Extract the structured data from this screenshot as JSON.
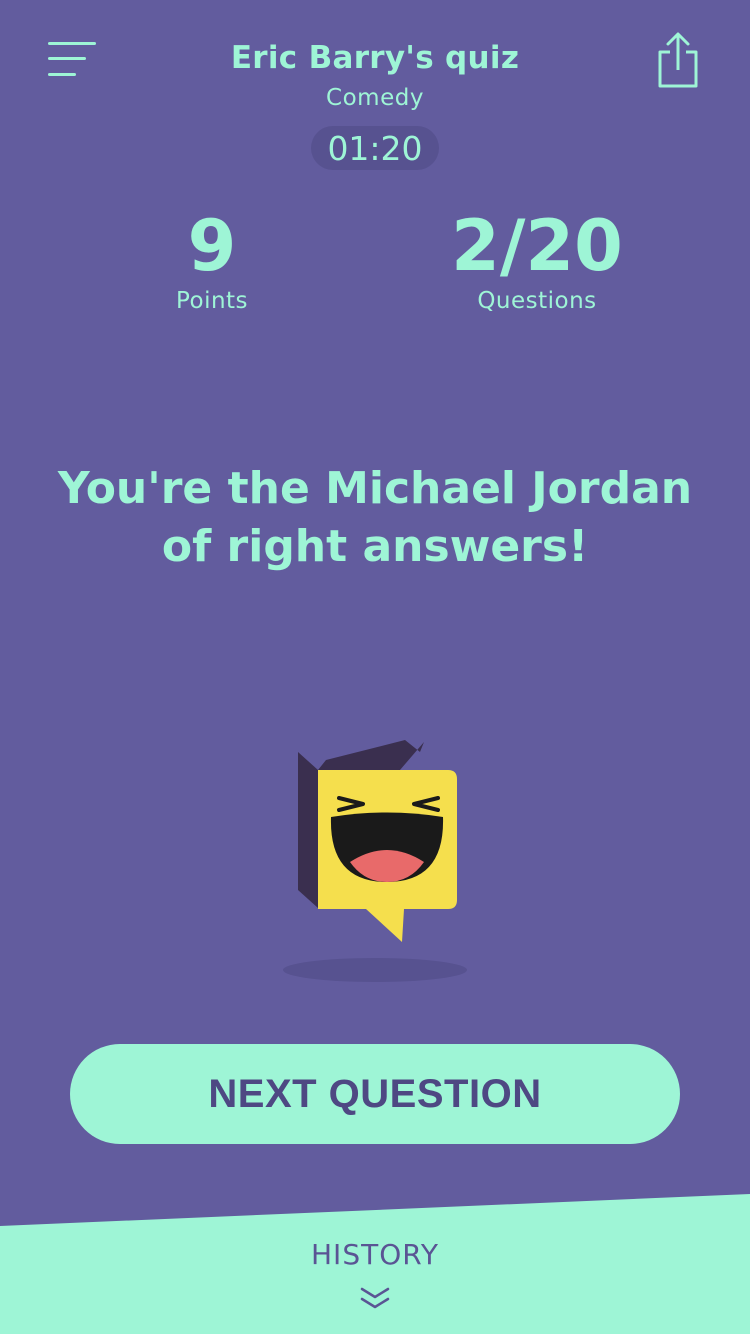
{
  "header": {
    "title": "Eric Barry's quiz",
    "category": "Comedy",
    "timer": "01:20",
    "menu_icon": "hamburger-menu-icon",
    "share_icon": "share-icon"
  },
  "stats": {
    "points_value": "9",
    "points_label": "Points",
    "questions_value": "2/20",
    "questions_label": "Questions"
  },
  "feedback": {
    "message": "You're the Michael Jordan of right answers!",
    "illustration": "laughing-speech-bubble-icon"
  },
  "actions": {
    "next_label": "NEXT QUESTION"
  },
  "history": {
    "label": "HISTORY",
    "icon": "double-chevron-down-icon"
  },
  "colors": {
    "background": "#625c9e",
    "accent": "#9ef5d6",
    "timer_bg": "#575290",
    "button_text": "#4e4883",
    "emoji_yellow": "#f5df4d",
    "emoji_tongue": "#e86a6a",
    "emoji_dark": "#3a2f4f"
  }
}
